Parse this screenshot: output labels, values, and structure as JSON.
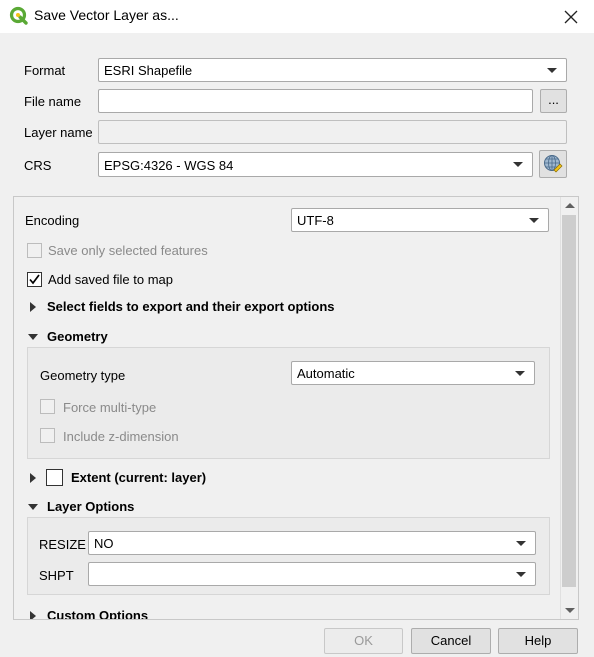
{
  "window": {
    "title": "Save Vector Layer as...",
    "logo_icon": "qgis-logo-icon",
    "close_icon": "close-icon"
  },
  "form": {
    "format_label": "Format",
    "format_value": "ESRI Shapefile",
    "filename_label": "File name",
    "filename_value": "",
    "browse_label": "...",
    "layername_label": "Layer name",
    "layername_value": "",
    "crs_label": "CRS",
    "crs_value": "EPSG:4326 - WGS 84"
  },
  "options": {
    "encoding_label": "Encoding",
    "encoding_value": "UTF-8",
    "save_selected_label": "Save only selected features",
    "save_selected_checked": false,
    "add_to_map_label": "Add saved file to map",
    "add_to_map_checked": true,
    "select_fields_label": "Select fields to export and their export options",
    "geometry_section": "Geometry",
    "geometry_type_label": "Geometry type",
    "geometry_type_value": "Automatic",
    "force_multi_label": "Force multi-type",
    "include_z_label": "Include z-dimension",
    "extent_label": "Extent (current: layer)",
    "layer_options_section": "Layer Options",
    "resize_label": "RESIZE",
    "resize_value": "NO",
    "shpt_label": "SHPT",
    "shpt_value": "",
    "custom_options_label": "Custom Options"
  },
  "buttons": {
    "ok": "OK",
    "cancel": "Cancel",
    "help": "Help"
  },
  "colors": {
    "logo_green": "#5aa935",
    "logo_yellow": "#f3c316",
    "disabled_text": "#8a8a8a"
  }
}
